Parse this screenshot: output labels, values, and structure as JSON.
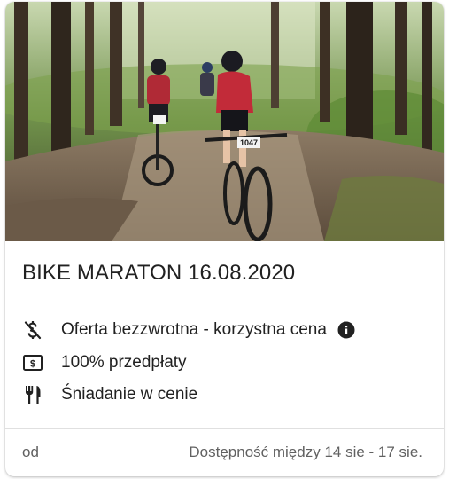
{
  "card": {
    "title": "BIKE MARATON 16.08.2020",
    "photo": {
      "subject": "mountain-bike-race-forest",
      "bib_number": "1047"
    },
    "features": [
      {
        "icon": "no-money-icon",
        "label": "Oferta bezzwrotna - korzystna cena",
        "has_info": true
      },
      {
        "icon": "cash-icon",
        "label": "100% przedpłaty",
        "has_info": false
      },
      {
        "icon": "cutlery-icon",
        "label": "Śniadanie w cenie",
        "has_info": false
      }
    ],
    "footer": {
      "from_label": "od",
      "availability": "Dostępność między 14 sie - 17 sie."
    }
  },
  "colors": {
    "text": "#212121",
    "muted": "#616161",
    "divider": "#e0e0e0"
  }
}
